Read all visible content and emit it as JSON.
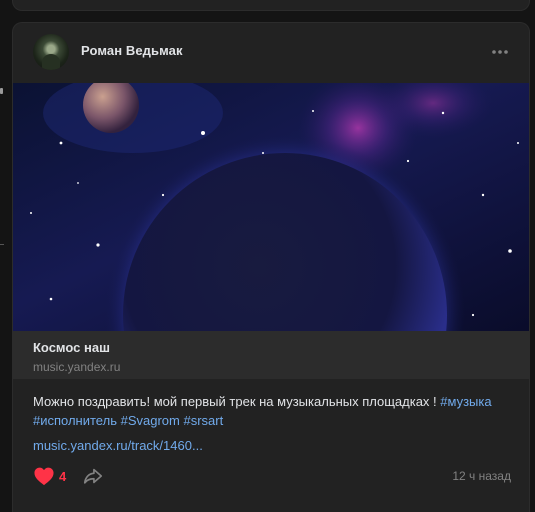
{
  "post": {
    "author": "Роман Ведьмак",
    "menu_icon": "more-horizontal-icon",
    "attachment": {
      "title": "Космос наш",
      "domain": "music.yandex.ru"
    },
    "text": {
      "body": "Можно поздравить! мой первый трек на музыкальных площадках ! ",
      "hashtags": [
        "#музыка",
        "#исполнитель",
        "#Svagrom",
        "#srsart"
      ],
      "link": "music.yandex.ru/track/1460..."
    },
    "actions": {
      "like_count": "4",
      "like_icon": "heart-icon",
      "share_icon": "share-icon"
    },
    "time": "12 ч назад"
  },
  "colors": {
    "background": "#141414",
    "card": "#222222",
    "link": "#71aaeb",
    "like": "#ff3347",
    "muted": "#828282"
  }
}
